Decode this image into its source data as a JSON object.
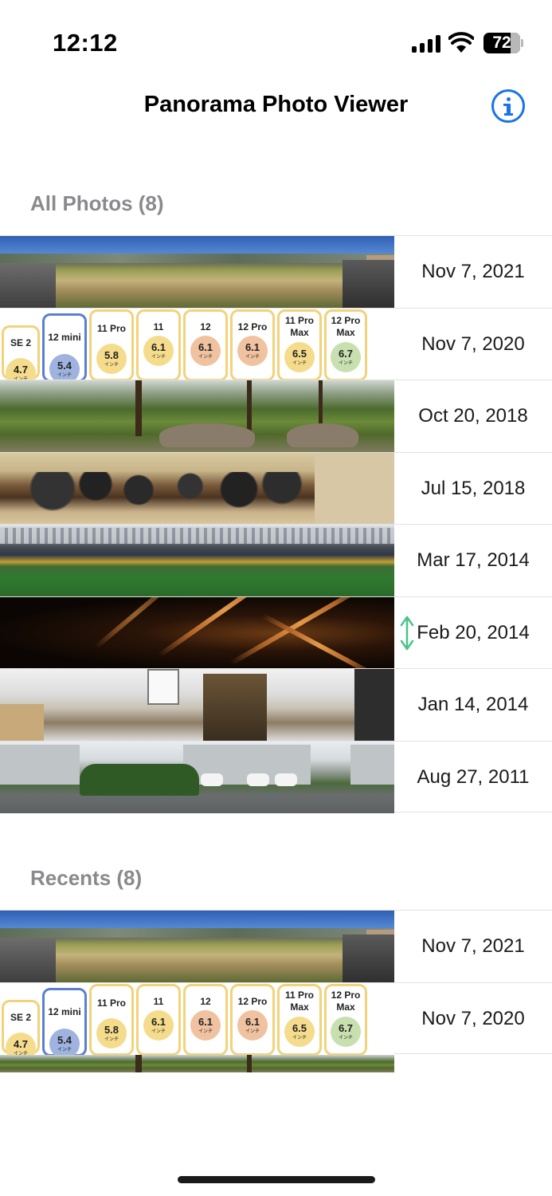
{
  "status_bar": {
    "time": "12:12",
    "battery_level": "72",
    "icons": [
      "cellular-signal-icon",
      "wifi-icon",
      "battery-icon"
    ]
  },
  "nav": {
    "title": "Panorama Photo Viewer",
    "info_icon": "info-circle-icon"
  },
  "accent_color": "#1a73e8",
  "sections": [
    {
      "title": "All Photos (8)",
      "rows": [
        {
          "date": "Nov 7, 2021",
          "thumbnail": "rural-field-panorama"
        },
        {
          "date": "Nov 7, 2020",
          "thumbnail": "iphone-size-comparison"
        },
        {
          "date": "Oct 20, 2018",
          "thumbnail": "forest-hike-panorama"
        },
        {
          "date": "Jul 15, 2018",
          "thumbnail": "dinner-party-panorama"
        },
        {
          "date": "Mar 17, 2014",
          "thumbnail": "stadium-panorama"
        },
        {
          "date": "Feb 20, 2014",
          "thumbnail": "dark-steel-structure-panorama"
        },
        {
          "date": "Jan 14, 2014",
          "thumbnail": "office-room-panorama"
        },
        {
          "date": "Aug 27, 2011",
          "thumbnail": "residential-street-panorama"
        }
      ]
    },
    {
      "title": "Recents (8)",
      "rows": [
        {
          "date": "Nov 7, 2021",
          "thumbnail": "rural-field-panorama"
        },
        {
          "date": "Nov 7, 2020",
          "thumbnail": "iphone-size-comparison"
        }
      ]
    }
  ],
  "iphone_models": [
    {
      "name": "SE 2",
      "size": "4.7",
      "unit": "インチ",
      "color": "#f5dc8c"
    },
    {
      "name": "12 mini",
      "size": "5.4",
      "unit": "インチ",
      "color": "#9fb3e0"
    },
    {
      "name": "11 Pro",
      "size": "5.8",
      "unit": "インチ",
      "color": "#f5dc8c"
    },
    {
      "name": "11",
      "size": "6.1",
      "unit": "インチ",
      "color": "#f5dc8c"
    },
    {
      "name": "12",
      "size": "6.1",
      "unit": "インチ",
      "color": "#f0c2a0"
    },
    {
      "name": "12 Pro",
      "size": "6.1",
      "unit": "インチ",
      "color": "#f0c2a0"
    },
    {
      "name": "11 Pro Max",
      "size": "6.5",
      "unit": "インチ",
      "color": "#f5dc8c"
    },
    {
      "name": "12 Pro Max",
      "size": "6.7",
      "unit": "インチ",
      "color": "#c8e0b0"
    }
  ]
}
